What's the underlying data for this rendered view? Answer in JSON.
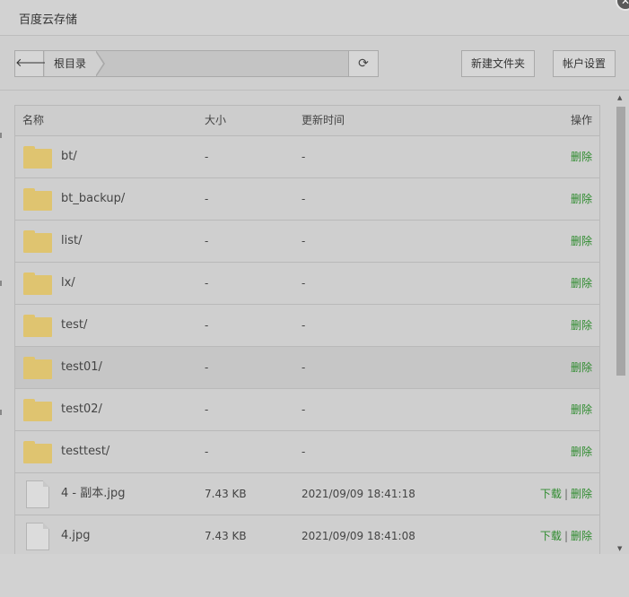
{
  "window": {
    "title": "百度云存储",
    "close_label": "✕"
  },
  "toolbar": {
    "back_label": "🡐",
    "breadcrumb": "根目录",
    "refresh_label": "⟳",
    "new_folder": "新建文件夹",
    "account_settings": "帐户设置"
  },
  "table": {
    "headers": {
      "name": "名称",
      "size": "大小",
      "time": "更新时间",
      "ops": "操作"
    },
    "rows": [
      {
        "type": "folder",
        "name": "bt/",
        "size": "-",
        "time": "-",
        "delete": "删除"
      },
      {
        "type": "folder",
        "name": "bt_backup/",
        "size": "-",
        "time": "-",
        "delete": "删除"
      },
      {
        "type": "folder",
        "name": "list/",
        "size": "-",
        "time": "-",
        "delete": "删除"
      },
      {
        "type": "folder",
        "name": "lx/",
        "size": "-",
        "time": "-",
        "delete": "删除"
      },
      {
        "type": "folder",
        "name": "test/",
        "size": "-",
        "time": "-",
        "delete": "删除"
      },
      {
        "type": "folder",
        "name": "test01/",
        "size": "-",
        "time": "-",
        "delete": "删除"
      },
      {
        "type": "folder",
        "name": "test02/",
        "size": "-",
        "time": "-",
        "delete": "删除"
      },
      {
        "type": "folder",
        "name": "testtest/",
        "size": "-",
        "time": "-",
        "delete": "删除"
      },
      {
        "type": "file",
        "name": "4 - 副本.jpg",
        "size": "7.43 KB",
        "time": "2021/09/09 18:41:18",
        "download": "下载",
        "sep": "|",
        "delete": "删除"
      },
      {
        "type": "file",
        "name": "4.jpg",
        "size": "7.43 KB",
        "time": "2021/09/09 18:41:08",
        "download": "下载",
        "sep": "|",
        "delete": "删除"
      }
    ]
  },
  "colors": {
    "accent_green": "#2e8b2e",
    "folder": "#dfc470"
  }
}
